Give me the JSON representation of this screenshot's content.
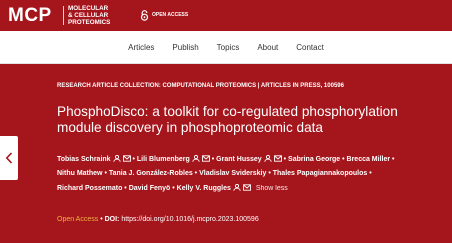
{
  "brand": {
    "logo": "MCP",
    "subtitle_lines": [
      "MOLECULAR",
      "& CELLULAR",
      "PROTEOMICS"
    ],
    "open_access_badge": "OPEN ACCESS"
  },
  "nav": {
    "items": [
      "Articles",
      "Publish",
      "Topics",
      "About",
      "Contact"
    ]
  },
  "article": {
    "kicker_collection": "RESEARCH ARTICLE COLLECTION: COMPUTATIONAL PROTEOMICS",
    "kicker_sep": " | ",
    "kicker_status": "ARTICLES IN PRESS",
    "kicker_id": ", 100596",
    "title": "PhosphoDisco: a toolkit for co-regulated phosphorylation module discovery in phosphoproteomic data",
    "authors": [
      {
        "name": "Tobias Schraink",
        "icons": [
          "person-icon",
          "email-icon"
        ]
      },
      {
        "name": "Lili Blumenberg",
        "icons": [
          "person-icon",
          "email-icon"
        ]
      },
      {
        "name": "Grant Hussey",
        "icons": [
          "person-icon",
          "email-icon"
        ]
      },
      {
        "name": "Sabrina George",
        "icons": []
      },
      {
        "name": "Brecca Miller",
        "icons": []
      },
      {
        "name": "Nithu Mathew",
        "icons": []
      },
      {
        "name": "Tania J. González-Robles",
        "icons": []
      },
      {
        "name": "Vladislav Sviderskiy",
        "icons": []
      },
      {
        "name": "Thales Papagiannakopoulos",
        "icons": []
      },
      {
        "name": "Richard Possemato",
        "icons": []
      },
      {
        "name": "David Fenyö",
        "icons": []
      },
      {
        "name": "Kelly V. Ruggles",
        "icons": [
          "person-icon",
          "email-icon"
        ]
      }
    ],
    "show_less": "Show less",
    "open_access": "Open Access",
    "doi_label": "DOI: ",
    "doi_link": "https://doi.org/10.1016/j.mcpro.2023.100596"
  },
  "colors": {
    "brand_red": "#a5151c",
    "open_access_orange": "#f0b43c"
  },
  "icons": {
    "prev": "chevron-left-icon"
  }
}
